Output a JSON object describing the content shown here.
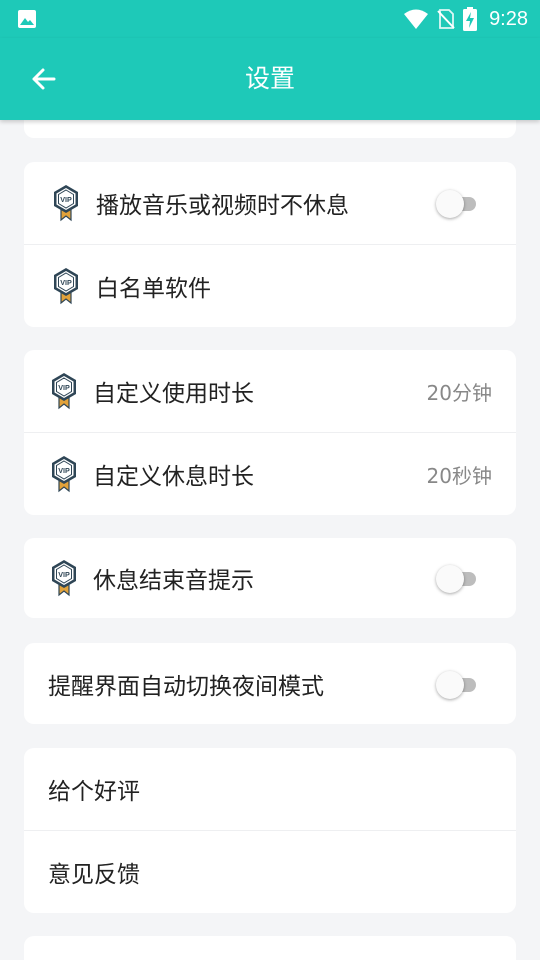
{
  "status_bar": {
    "time": "9:28",
    "icons": [
      "image-icon",
      "wifi-icon",
      "no-sim-icon",
      "battery-charging-icon"
    ]
  },
  "app_bar": {
    "title": "设置",
    "back_icon": "arrow-left-icon"
  },
  "colors": {
    "primary": "#1ec9b8",
    "background": "#f4f5f7",
    "vip_gold": "#e2a23a",
    "vip_dark": "#2f4656"
  },
  "sections": {
    "media": {
      "pause_on_media": {
        "label": "播放音乐或视频时不休息",
        "enabled": false,
        "vip": true
      },
      "whitelist": {
        "label": "白名单软件",
        "vip": true
      }
    },
    "durations": {
      "usage": {
        "label": "自定义使用时长",
        "value": "20分钟",
        "vip": true
      },
      "rest": {
        "label": "自定义休息时长",
        "value": "20秒钟",
        "vip": true
      }
    },
    "sound": {
      "rest_end_sound": {
        "label": "休息结束音提示",
        "enabled": false,
        "vip": true
      }
    },
    "night": {
      "auto_night_mode": {
        "label": "提醒界面自动切换夜间模式",
        "enabled": false
      }
    },
    "feedback": {
      "rate": {
        "label": "给个好评"
      },
      "feedback": {
        "label": "意见反馈"
      }
    }
  }
}
